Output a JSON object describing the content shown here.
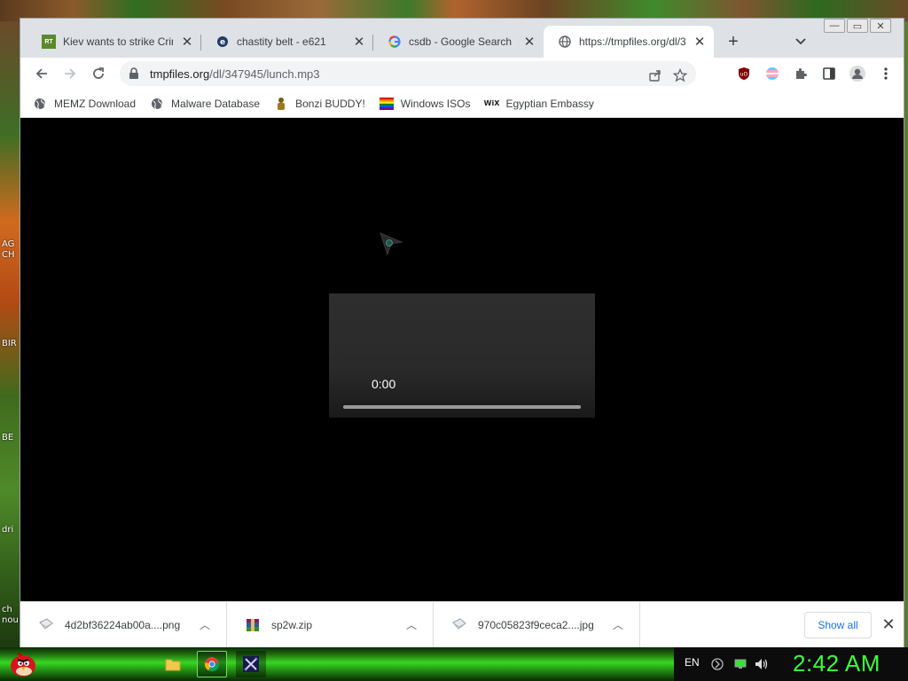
{
  "browser": {
    "tabs": [
      {
        "title": "Kiev wants to strike Crim",
        "icon": "rt-favicon"
      },
      {
        "title": "chastity belt - e621",
        "icon": "e621-favicon"
      },
      {
        "title": "csdb - Google Search",
        "icon": "google-favicon"
      },
      {
        "title": "https://tmpfiles.org/dl/3",
        "icon": "globe-favicon",
        "active": true
      }
    ],
    "url": {
      "host": "tmpfiles.org",
      "path": "/dl/347945/lunch.mp3"
    },
    "bookmarks": [
      {
        "label": "MEMZ Download",
        "icon": "globe-icon"
      },
      {
        "label": "Malware Database",
        "icon": "globe-icon"
      },
      {
        "label": "Bonzi BUDDY!",
        "icon": "bonzi-icon"
      },
      {
        "label": "Windows ISOs",
        "icon": "rainbow-flag-icon"
      },
      {
        "label": "Egyptian Embassy",
        "icon": "wix-icon"
      }
    ]
  },
  "player": {
    "current_time": "0:00",
    "progress": 0
  },
  "downloads": {
    "items": [
      {
        "name": "4d2bf36224ab00a....png",
        "icon": "image-file-icon"
      },
      {
        "name": "sp2w.zip",
        "icon": "winrar-icon"
      },
      {
        "name": "970c05823f9ceca2....jpg",
        "icon": "image-file-icon"
      }
    ],
    "show_all": "Show all"
  },
  "desktop": {
    "side_labels": [
      "AG",
      "CH",
      "BIR",
      "BE",
      "dri",
      "ch",
      "nou"
    ]
  },
  "taskbar": {
    "language": "EN",
    "clock": "2:42 AM",
    "apps": [
      "file-explorer-icon",
      "chrome-icon",
      "sword-app-icon"
    ]
  },
  "colors": {
    "clock": "#3cff3c",
    "taskbar_green": "#39d622",
    "accent": "#1a73e8"
  }
}
